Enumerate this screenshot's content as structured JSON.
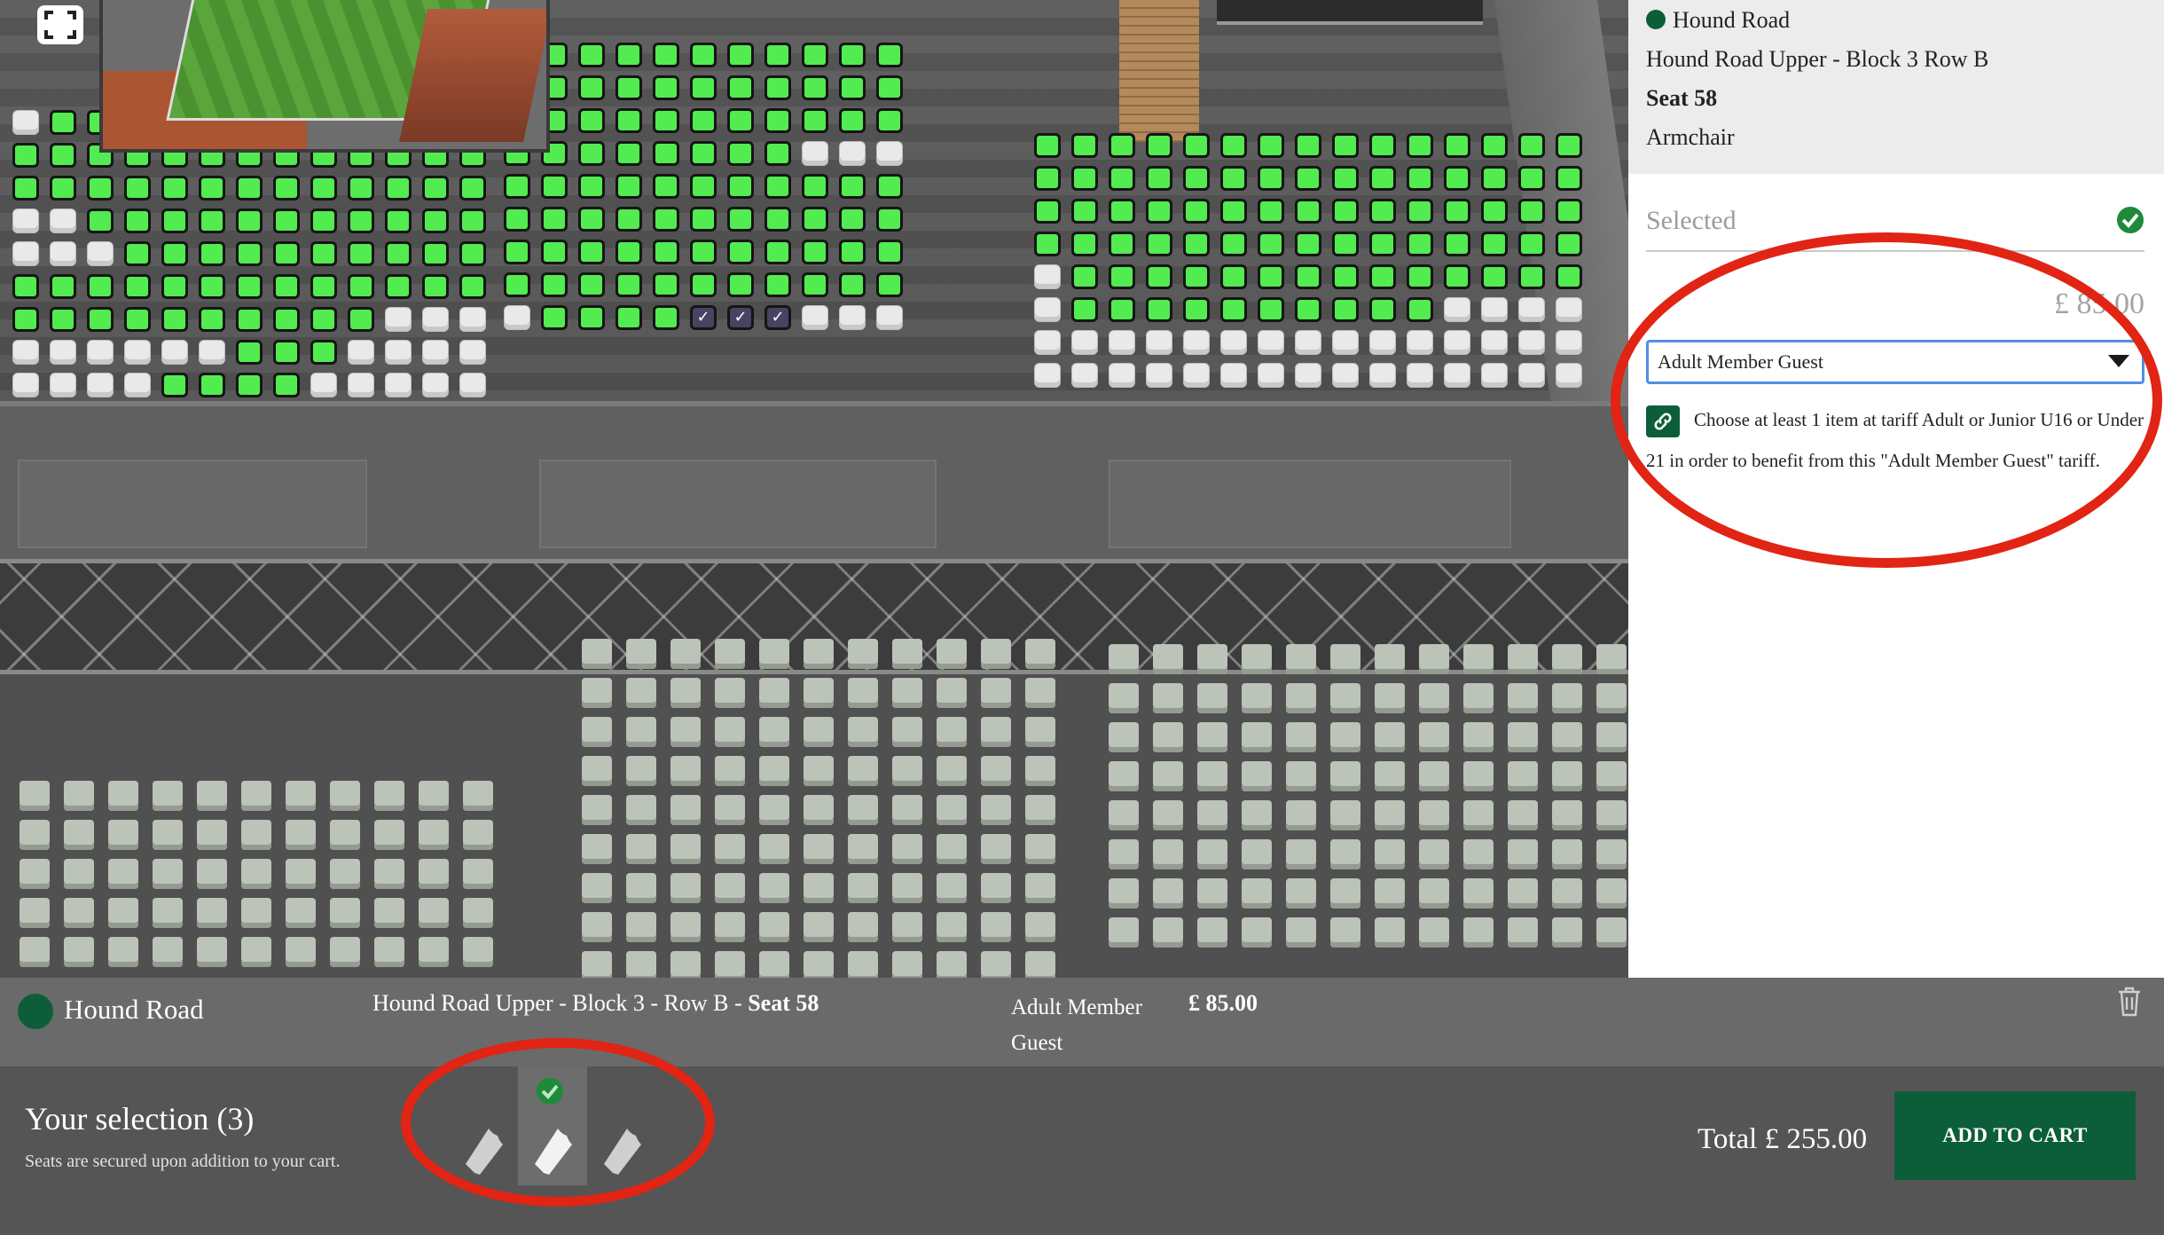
{
  "seat_details": {
    "stand_name": "Hound Road",
    "block_row": "Hound Road Upper - Block 3 Row B",
    "seat": "Seat 58",
    "seat_type": "Armchair",
    "status_label": "Selected",
    "price": "£ 85.00",
    "tariff_selected": "Adult Member Guest",
    "tariff_info": "Choose at least 1 item at tariff Adult or Junior U16 or Under 21 in order to benefit from this \"Adult Member Guest\" tariff."
  },
  "cart_line": {
    "stand_name": "Hound Road",
    "location": "Hound Road Upper - Block 3 - Row B - ",
    "seat": "Seat 58",
    "tariff_line1": "Adult Member",
    "tariff_line2": "Guest",
    "price": "£ 85.00"
  },
  "selection": {
    "title": "Your selection (3)",
    "note": "Seats are secured upon addition to your cart.",
    "total": "Total £ 255.00",
    "add_to_cart": "ADD TO CART"
  },
  "colors": {
    "brand_green": "#0c5e3a",
    "seat_available": "#52ec50",
    "seat_selected": "#4a4262",
    "annotation_red": "#e12413"
  },
  "icons": [
    "fullscreen-icon",
    "check-circle-icon",
    "chevron-down-icon",
    "link-icon",
    "trash-icon",
    "ticket-icon"
  ]
}
